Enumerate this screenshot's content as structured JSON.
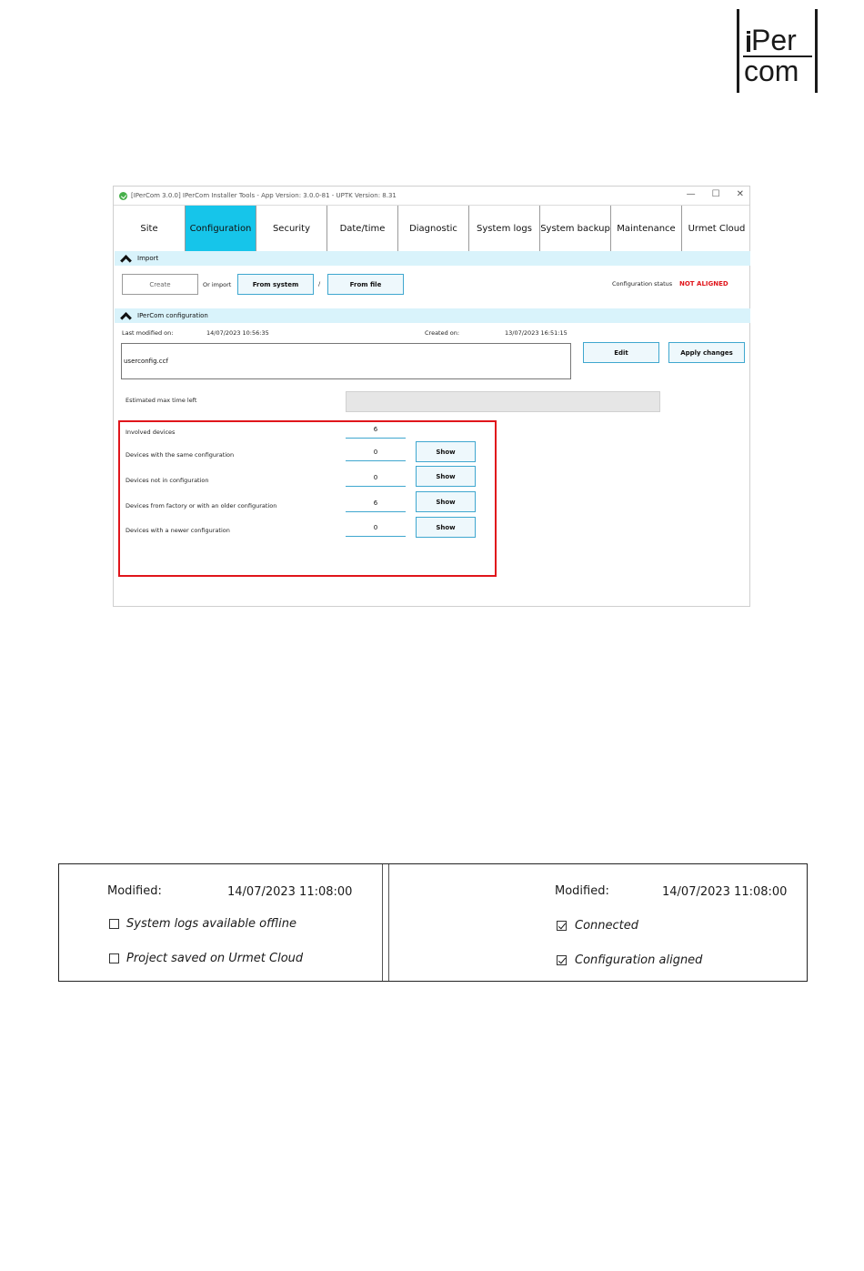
{
  "logo": {
    "line1": "Per",
    "line2": "com"
  },
  "window": {
    "title": "[IPerCom 3.0.0] IPerCom Installer Tools - App Version: 3.0.0-81 - UPTK Version: 8.31",
    "controls": {
      "minimize": "—",
      "maximize": "☐",
      "close": "✕"
    }
  },
  "tabs": [
    {
      "label": "Site"
    },
    {
      "label": "Configuration",
      "active": true
    },
    {
      "label": "Security"
    },
    {
      "label": "Date/time"
    },
    {
      "label": "Diagnostic"
    },
    {
      "label": "System logs"
    },
    {
      "label": "System backup"
    },
    {
      "label": "Maintenance"
    },
    {
      "label": "Urmet Cloud"
    }
  ],
  "import_section": {
    "title": "Import",
    "create_label": "Create",
    "or_import": "Or import",
    "from_system": "From system",
    "slash": "/",
    "from_file": "From file",
    "status_label": "Configuration status",
    "status_value": "NOT ALIGNED"
  },
  "config_section": {
    "title": "IPerCom configuration",
    "last_modified_label": "Last modified on:",
    "last_modified_value": "14/07/2023 10:56:35",
    "created_label": "Created on:",
    "created_value": "13/07/2023 16:51:15",
    "filename": "userconfig.ccf",
    "edit_label": "Edit",
    "apply_label": "Apply changes",
    "estimated_label": "Estimated max time left"
  },
  "devices": [
    {
      "label": "Involved devices",
      "value": "6",
      "has_show": false
    },
    {
      "label": "Devices with the same configuration",
      "value": "0",
      "has_show": true
    },
    {
      "label": "Devices not in configuration",
      "value": "0",
      "has_show": true
    },
    {
      "label": "Devices from factory or with an older configuration",
      "value": "6",
      "has_show": true
    },
    {
      "label": "Devices with a newer configuration",
      "value": "0",
      "has_show": true
    }
  ],
  "show_label": "Show",
  "status_panel": {
    "left": {
      "modified_label": "Modified:",
      "modified_value": "14/07/2023 11:08:00",
      "checks": [
        {
          "label": "System logs available offline",
          "checked": false
        },
        {
          "label": "Project saved on Urmet Cloud",
          "checked": false
        }
      ]
    },
    "right": {
      "modified_label": "Modified:",
      "modified_value": "14/07/2023 11:08:00",
      "checks": [
        {
          "label": "Connected",
          "checked": true
        },
        {
          "label": "Configuration aligned",
          "checked": true
        }
      ]
    }
  }
}
